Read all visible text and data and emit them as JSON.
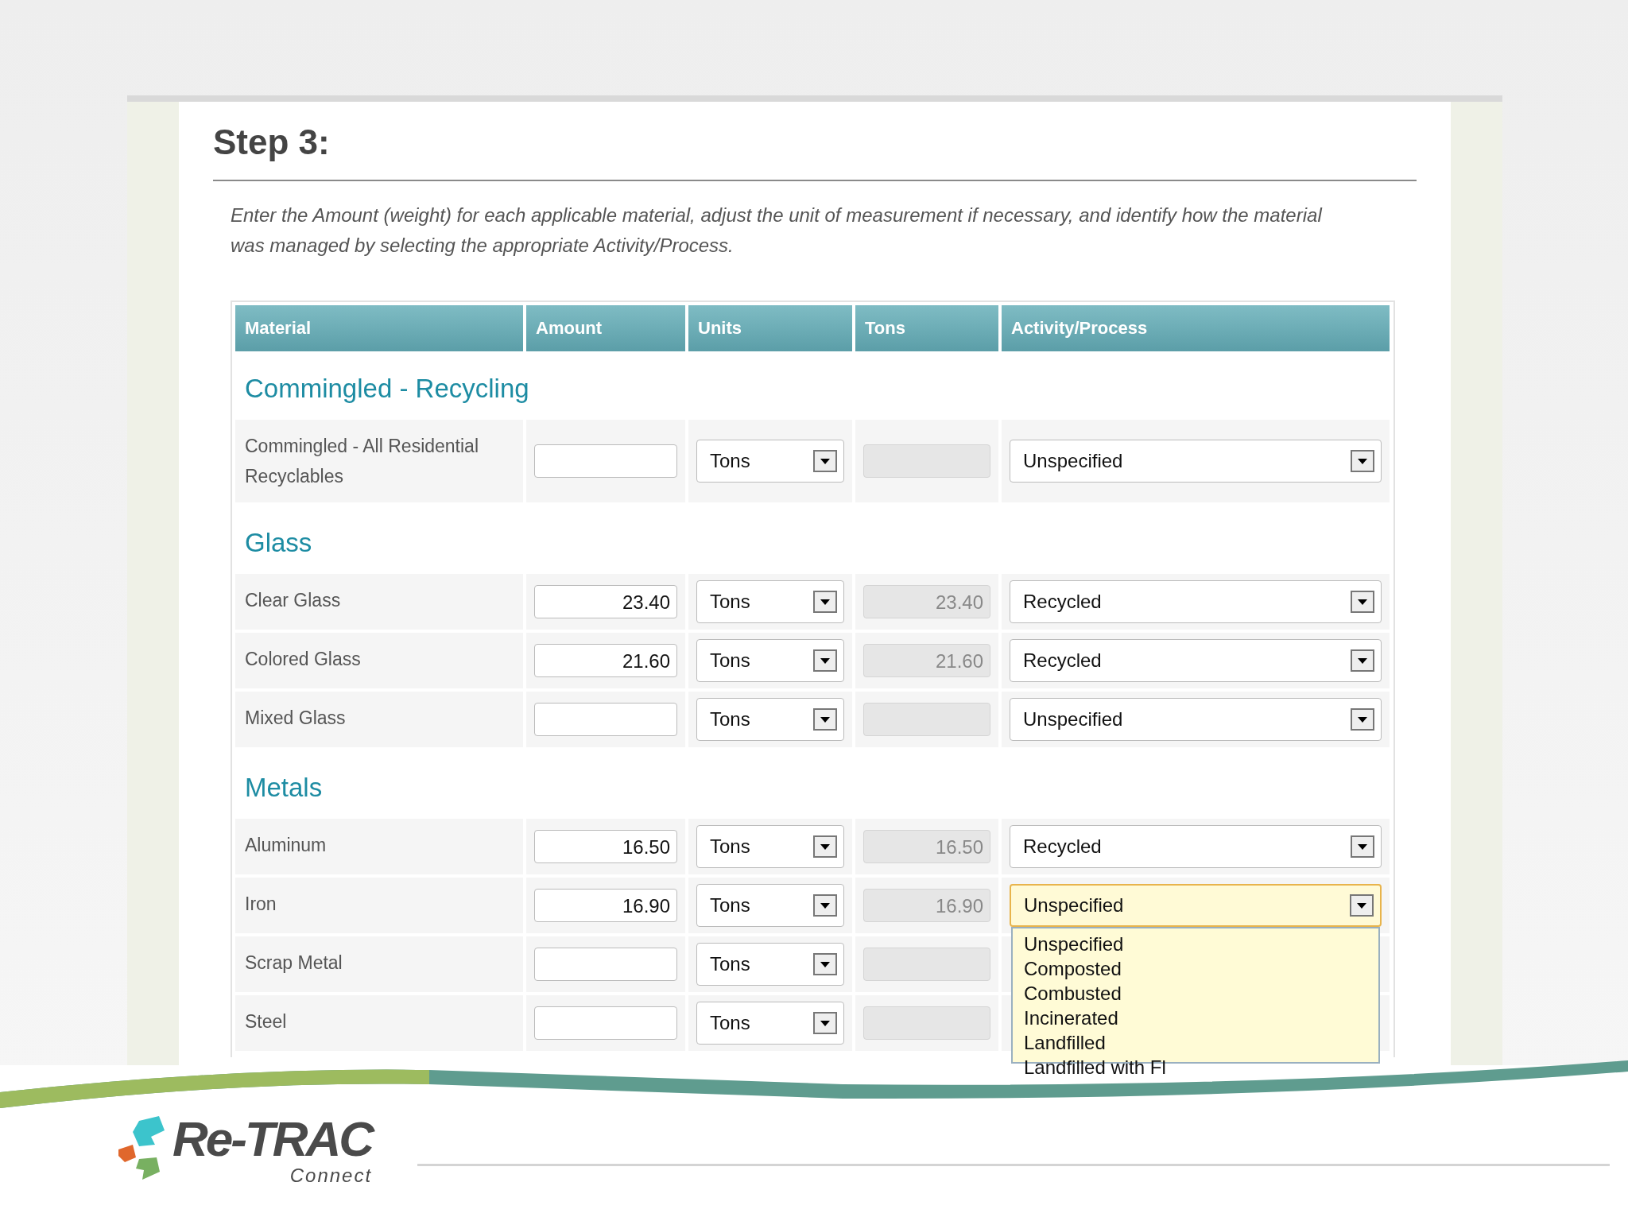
{
  "page": {
    "heading": "Step 3:",
    "instructions": "Enter the Amount (weight) for each applicable material, adjust the unit of measurement if necessary, and identify how the material was managed by selecting the appropriate Activity/Process."
  },
  "table": {
    "columns": [
      "Material",
      "Amount",
      "Units",
      "Tons",
      "Activity/Process"
    ],
    "sections": [
      {
        "title": "Commingled - Recycling",
        "rows": [
          {
            "material": "Commingled - All Residential Recyclables",
            "units": "Tons",
            "activity": "Unspecified"
          }
        ]
      },
      {
        "title": "Glass",
        "rows": [
          {
            "material": "Clear Glass",
            "amount": "23.40",
            "units": "Tons",
            "tons": "23.40",
            "activity": "Recycled"
          },
          {
            "material": "Colored Glass",
            "amount": "21.60",
            "units": "Tons",
            "tons": "21.60",
            "activity": "Recycled"
          },
          {
            "material": "Mixed Glass",
            "units": "Tons",
            "activity": "Unspecified"
          }
        ]
      },
      {
        "title": "Metals",
        "rows": [
          {
            "material": "Aluminum",
            "amount": "16.50",
            "units": "Tons",
            "tons": "16.50",
            "activity": "Recycled"
          },
          {
            "material": "Iron",
            "amount": "16.90",
            "units": "Tons",
            "tons": "16.90",
            "activity": "Unspecified",
            "open": true,
            "options": [
              "Unspecified",
              "Composted",
              "Combusted",
              "Incinerated",
              "Landfilled",
              "Landfilled with Fl"
            ]
          },
          {
            "material": "Scrap Metal",
            "units": "Tons"
          },
          {
            "material": "Steel",
            "units": "Tons"
          }
        ]
      }
    ]
  },
  "footer": {
    "logo_text": "Re-TRAC",
    "logo_subtext": "Connect"
  }
}
